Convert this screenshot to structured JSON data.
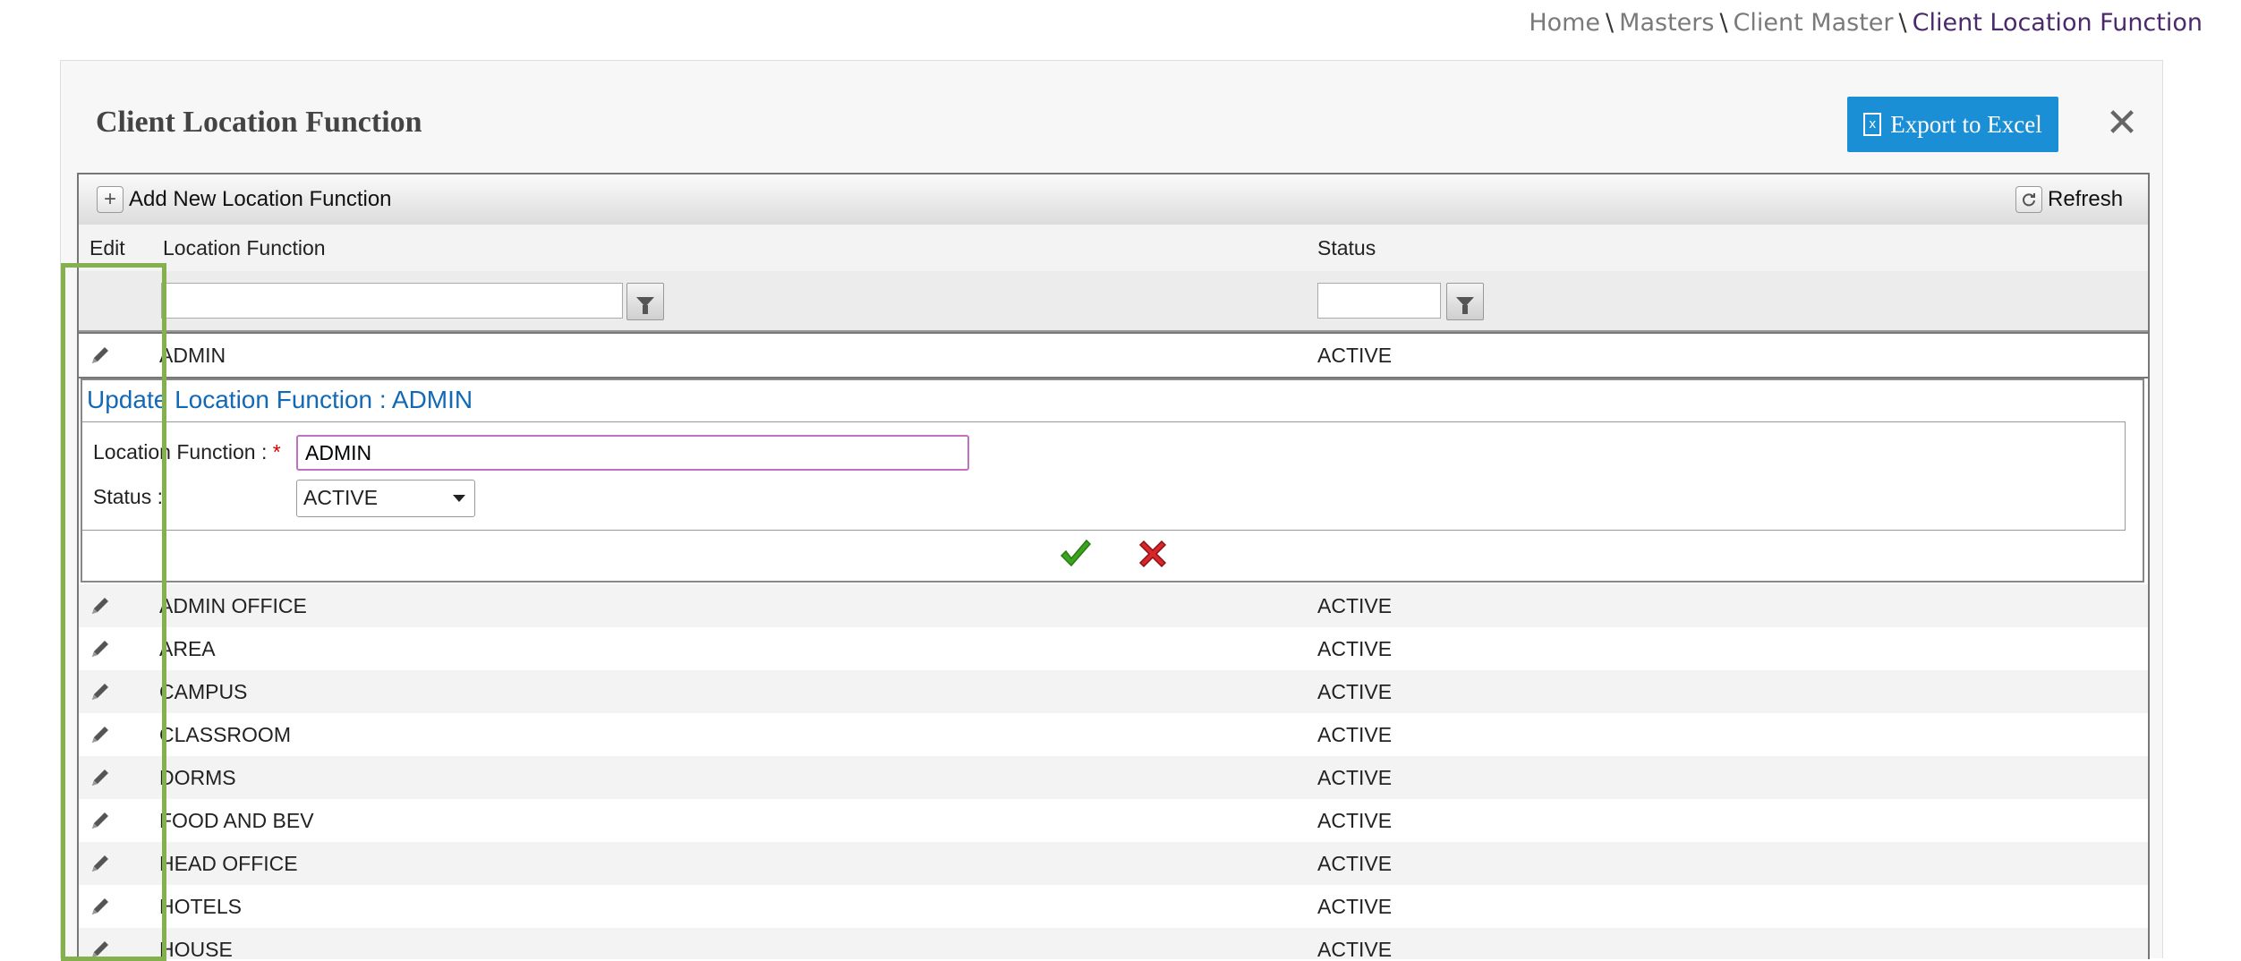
{
  "breadcrumb": {
    "items": [
      "Home",
      "Masters",
      "Client Master"
    ],
    "separator": "\\",
    "current": "Client Location Function"
  },
  "panel": {
    "title": "Client Location Function",
    "export_label": "Export to Excel",
    "close_label": "✕"
  },
  "toolbar": {
    "add_label": "Add New Location Function",
    "refresh_label": "Refresh"
  },
  "columns": {
    "edit": "Edit",
    "location_function": "Location Function",
    "status": "Status"
  },
  "filters": {
    "location_function_value": "",
    "status_value": ""
  },
  "selected_row": {
    "name": "ADMIN",
    "status": "ACTIVE"
  },
  "edit_form": {
    "title": "Update Location Function : ADMIN",
    "location_label": "Location Function :",
    "required_mark": "*",
    "location_value": "ADMIN",
    "status_label": "Status :",
    "status_value": "ACTIVE"
  },
  "rows": [
    {
      "name": "ADMIN OFFICE",
      "status": "ACTIVE"
    },
    {
      "name": "AREA",
      "status": "ACTIVE"
    },
    {
      "name": "CAMPUS",
      "status": "ACTIVE"
    },
    {
      "name": "CLASSROOM",
      "status": "ACTIVE"
    },
    {
      "name": "DORMS",
      "status": "ACTIVE"
    },
    {
      "name": "FOOD AND BEV",
      "status": "ACTIVE"
    },
    {
      "name": "HEAD OFFICE",
      "status": "ACTIVE"
    },
    {
      "name": "HOTELS",
      "status": "ACTIVE"
    },
    {
      "name": "HOUSE",
      "status": "ACTIVE"
    }
  ],
  "colors": {
    "accent": "#1a8fd6",
    "breadcrumb_current": "#4b2a6b",
    "form_title": "#1469b5",
    "highlight": "#85b04e"
  }
}
